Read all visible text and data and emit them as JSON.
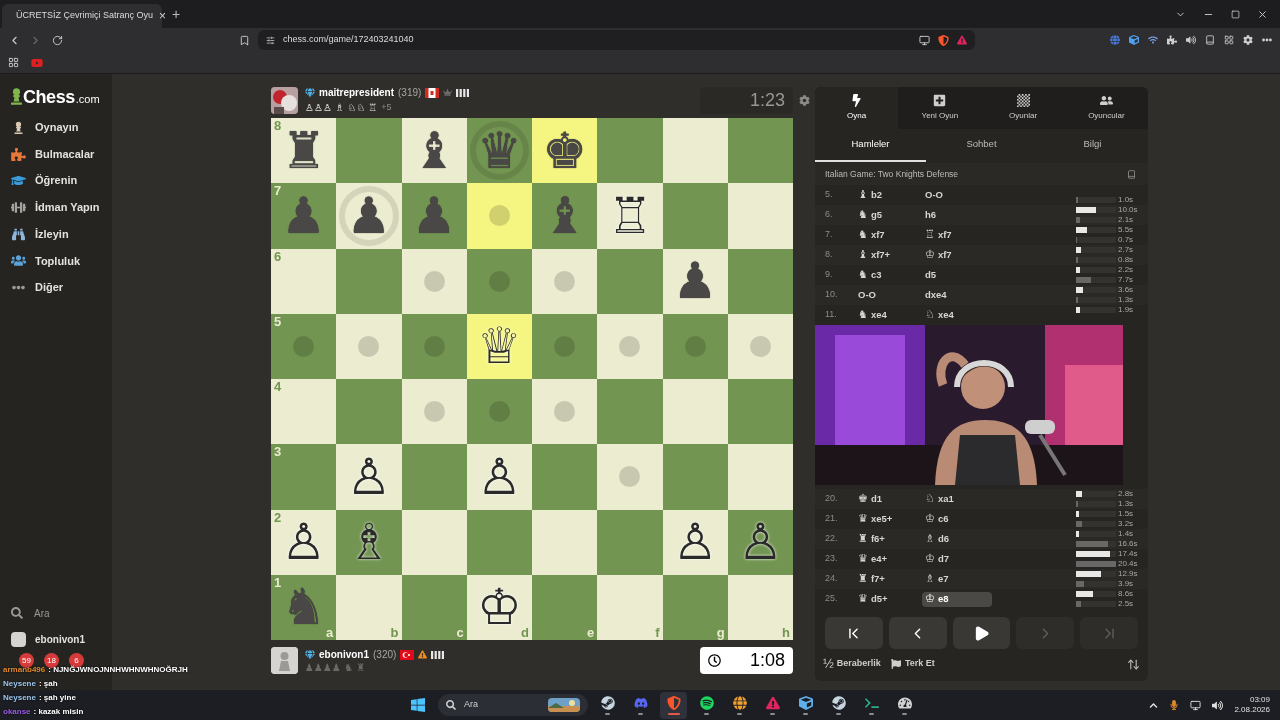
{
  "browser": {
    "tab_title": "ÜCRETSİZ Çevrimiçi Satranç Oyu",
    "tab_close": "×",
    "new_tab": "+",
    "url": "chess.com/game/172403241040"
  },
  "sidebar": {
    "logo": "Chess",
    "logo_suffix": ".com",
    "items": [
      {
        "kind": "pawn",
        "label": "Oynayın",
        "color": "#d9cbb3"
      },
      {
        "kind": "puzzle",
        "label": "Bulmacalar",
        "color": "#e8773a"
      },
      {
        "kind": "cap",
        "label": "Öğrenin",
        "color": "#3b9bd8"
      },
      {
        "kind": "dumbbell",
        "label": "İdman Yapın",
        "color": "#a3a3a3"
      },
      {
        "kind": "binoculars",
        "label": "İzleyin",
        "color": "#8fb6d9"
      },
      {
        "kind": "people",
        "label": "Topluluk",
        "color": "#5ba2d9"
      },
      {
        "kind": "dots",
        "label": "Diğer",
        "color": "#9a9a9a"
      }
    ],
    "search": "Ara",
    "user": "ebonivon1"
  },
  "top_player": {
    "name": "maitrepresident",
    "rating": "(319)",
    "flag": {
      "kind": "canada"
    },
    "badge": {
      "kind": "crown"
    },
    "captured": "♙♙♙ ♗ ♘♘ ♖",
    "advantage": "+5",
    "clock": "1:23",
    "active": false
  },
  "board": {
    "ranks": [
      {
        "squares": [
          {
            "piece": "♜",
            "white": false,
            "highlighted": false,
            "rank_label": "8"
          },
          {
            "highlighted": false
          },
          {
            "piece": "♝",
            "white": false,
            "highlighted": false
          },
          {
            "piece": "♛",
            "white": false,
            "highlighted": false,
            "kind": "capture"
          },
          {
            "piece": "♚",
            "white": false,
            "highlighted": true
          },
          {
            "highlighted": false
          },
          {
            "highlighted": false
          },
          {
            "highlighted": false
          }
        ]
      },
      {
        "squares": [
          {
            "piece": "♟",
            "white": false,
            "highlighted": false,
            "rank_label": "7"
          },
          {
            "piece": "♟",
            "white": false,
            "highlighted": false,
            "kind": "capture"
          },
          {
            "piece": "♟",
            "white": false,
            "highlighted": false
          },
          {
            "highlighted": true,
            "kind": "dot"
          },
          {
            "piece": "♝",
            "white": false,
            "highlighted": false
          },
          {
            "piece": "♖",
            "white": true,
            "highlighted": false
          },
          {
            "highlighted": false
          },
          {
            "highlighted": false
          }
        ]
      },
      {
        "squares": [
          {
            "highlighted": false,
            "rank_label": "6"
          },
          {
            "highlighted": false
          },
          {
            "highlighted": false,
            "kind": "dot"
          },
          {
            "highlighted": false,
            "kind": "dot"
          },
          {
            "highlighted": false,
            "kind": "dot"
          },
          {
            "highlighted": false
          },
          {
            "piece": "♟",
            "white": false,
            "highlighted": false
          },
          {
            "highlighted": false
          }
        ]
      },
      {
        "squares": [
          {
            "highlighted": false,
            "kind": "dot",
            "rank_label": "5"
          },
          {
            "highlighted": false,
            "kind": "dot"
          },
          {
            "highlighted": false,
            "kind": "dot"
          },
          {
            "piece": "♕",
            "white": true,
            "highlighted": true
          },
          {
            "highlighted": false,
            "kind": "dot"
          },
          {
            "highlighted": false,
            "kind": "dot"
          },
          {
            "highlighted": false,
            "kind": "dot"
          },
          {
            "highlighted": false,
            "kind": "dot"
          }
        ]
      },
      {
        "squares": [
          {
            "highlighted": false,
            "rank_label": "4"
          },
          {
            "highlighted": false
          },
          {
            "highlighted": false,
            "kind": "dot"
          },
          {
            "highlighted": false,
            "kind": "dot"
          },
          {
            "highlighted": false,
            "kind": "dot"
          },
          {
            "highlighted": false
          },
          {
            "highlighted": false
          },
          {
            "highlighted": false
          }
        ]
      },
      {
        "squares": [
          {
            "highlighted": false,
            "rank_label": "3"
          },
          {
            "piece": "♙",
            "white": true,
            "highlighted": false
          },
          {
            "highlighted": false
          },
          {
            "piece": "♙",
            "white": true,
            "highlighted": false
          },
          {
            "highlighted": false
          },
          {
            "highlighted": false,
            "kind": "dot"
          },
          {
            "highlighted": false
          },
          {
            "highlighted": false
          }
        ]
      },
      {
        "squares": [
          {
            "piece": "♙",
            "white": true,
            "highlighted": false,
            "rank_label": "2"
          },
          {
            "piece": "♗",
            "white": true,
            "highlighted": false
          },
          {
            "highlighted": false
          },
          {
            "highlighted": false
          },
          {
            "highlighted": false
          },
          {
            "highlighted": false
          },
          {
            "piece": "♙",
            "white": true,
            "highlighted": false
          },
          {
            "piece": "♙",
            "white": true,
            "highlighted": false
          }
        ]
      },
      {
        "squares": [
          {
            "piece": "♞",
            "white": false,
            "highlighted": false,
            "rank_label": "1",
            "file_label": "a"
          },
          {
            "highlighted": false,
            "file_label": "b"
          },
          {
            "highlighted": false,
            "file_label": "c"
          },
          {
            "piece": "♔",
            "white": true,
            "highlighted": false,
            "file_label": "d"
          },
          {
            "highlighted": false,
            "file_label": "e"
          },
          {
            "highlighted": false,
            "file_label": "f"
          },
          {
            "highlighted": false,
            "file_label": "g"
          },
          {
            "highlighted": false,
            "file_label": "h"
          }
        ]
      }
    ]
  },
  "bottom_player": {
    "name": "ebonivon1",
    "rating": "(320)",
    "flag": {
      "kind": "turkey"
    },
    "badge": {
      "kind": "warning"
    },
    "captured": "♟♟♟♟ ♞ ♜",
    "clock": "1:08",
    "active": true
  },
  "panel": {
    "tabs": [
      {
        "kind": "bolt",
        "label": "Oyna",
        "selected": true
      },
      {
        "kind": "plus",
        "label": "Yeni Oyun",
        "selected": false
      },
      {
        "kind": "board",
        "label": "Oyunlar",
        "selected": false
      },
      {
        "kind": "users",
        "label": "Oyuncular",
        "selected": false
      }
    ],
    "subtabs": [
      {
        "label": "Hamleler",
        "selected": true
      },
      {
        "label": "Sohbet",
        "selected": false
      },
      {
        "label": "Bilgi",
        "selected": false
      }
    ],
    "opening": "Italian Game: Two Knights Defense",
    "moves_before": [
      {
        "number": "5.",
        "white": {
          "piece": "♝",
          "san": "b2",
          "selected": false
        },
        "black": {
          "san": "O-O",
          "selected": false
        },
        "black_time": {
          "text": "1.0s",
          "level": 0.05
        }
      },
      {
        "number": "6.",
        "white": {
          "piece": "♞",
          "san": "g5",
          "selected": false
        },
        "black": {
          "san": "h6",
          "selected": false
        },
        "white_time": {
          "text": "10.0s",
          "level": 0.49
        },
        "black_time": {
          "text": "2.1s",
          "level": 0.1
        }
      },
      {
        "number": "7.",
        "white": {
          "piece": "♞",
          "san": "xf7",
          "selected": false
        },
        "black": {
          "piece": "♖",
          "san": "xf7",
          "selected": false
        },
        "white_time": {
          "text": "5.5s",
          "level": 0.27
        },
        "black_time": {
          "text": "0.7s",
          "level": 0.03
        }
      },
      {
        "number": "8.",
        "white": {
          "piece": "♝",
          "san": "xf7+",
          "selected": false
        },
        "black": {
          "piece": "♔",
          "san": "xf7",
          "selected": false
        },
        "white_time": {
          "text": "2.7s",
          "level": 0.13
        },
        "black_time": {
          "text": "0.8s",
          "level": 0.04
        }
      },
      {
        "number": "9.",
        "white": {
          "piece": "♞",
          "san": "c3",
          "selected": false
        },
        "black": {
          "san": "d5",
          "selected": false
        },
        "white_time": {
          "text": "2.2s",
          "level": 0.11
        },
        "black_time": {
          "text": "7.7s",
          "level": 0.38
        }
      },
      {
        "number": "10.",
        "white": {
          "san": "O-O",
          "selected": false
        },
        "black": {
          "san": "dxe4",
          "selected": false
        },
        "white_time": {
          "text": "3.6s",
          "level": 0.18
        },
        "black_time": {
          "text": "1.3s",
          "level": 0.06
        }
      },
      {
        "number": "11.",
        "white": {
          "piece": "♞",
          "san": "xe4",
          "selected": false
        },
        "black": {
          "piece": "♘",
          "san": "xe4",
          "selected": false
        },
        "white_time": {
          "text": "1.9s",
          "level": 0.09
        }
      }
    ],
    "moves_after": [
      {
        "number": "20.",
        "white": {
          "piece": "♚",
          "san": "d1",
          "selected": false
        },
        "black": {
          "piece": "♘",
          "san": "xa1",
          "selected": false
        },
        "white_time": {
          "text": "2.8s",
          "level": 0.14
        },
        "black_time": {
          "text": "1.3s",
          "level": 0.06
        }
      },
      {
        "number": "21.",
        "white": {
          "piece": "♛",
          "san": "xe5+",
          "selected": false
        },
        "black": {
          "piece": "♔",
          "san": "c6",
          "selected": false
        },
        "white_time": {
          "text": "1.5s",
          "level": 0.07
        },
        "black_time": {
          "text": "3.2s",
          "level": 0.16
        }
      },
      {
        "number": "22.",
        "white": {
          "piece": "♜",
          "san": "f6+",
          "selected": false
        },
        "black": {
          "piece": "♗",
          "san": "d6",
          "selected": false
        },
        "white_time": {
          "text": "1.4s",
          "level": 0.07
        },
        "black_time": {
          "text": "16.6s",
          "level": 0.81
        }
      },
      {
        "number": "23.",
        "white": {
          "piece": "♛",
          "san": "e4+",
          "selected": false
        },
        "black": {
          "piece": "♔",
          "san": "d7",
          "selected": false
        },
        "white_time": {
          "text": "17.4s",
          "level": 0.85
        },
        "black_time": {
          "text": "20.4s",
          "level": 1
        }
      },
      {
        "number": "24.",
        "white": {
          "piece": "♜",
          "san": "f7+",
          "selected": false
        },
        "black": {
          "piece": "♗",
          "san": "e7",
          "selected": false
        },
        "white_time": {
          "text": "12.9s",
          "level": 0.63
        },
        "black_time": {
          "text": "3.9s",
          "level": 0.19
        }
      },
      {
        "number": "25.",
        "white": {
          "piece": "♛",
          "san": "d5+",
          "selected": false
        },
        "black": {
          "piece": "♔",
          "san": "e8",
          "selected": true
        },
        "white_time": {
          "text": "8.6s",
          "level": 0.42
        },
        "black_time": {
          "text": "2.5s",
          "level": 0.12
        }
      }
    ],
    "nav": [
      {
        "kind": "first",
        "disabled": false
      },
      {
        "kind": "prev",
        "disabled": false
      },
      {
        "kind": "play",
        "disabled": false
      },
      {
        "kind": "next",
        "disabled": true
      },
      {
        "kind": "last",
        "disabled": true
      }
    ],
    "draw_glyph": "½",
    "draw_label": "Beraberlik",
    "resign_label": "Terk Et"
  },
  "chat": {
    "badges": [
      "59",
      "18",
      "6"
    ],
    "messages": [
      {
        "user": "armanb496",
        "text": ": NJNĞJWNOJNNHWHNWHNOĞRJH",
        "color": "#e0892e"
      },
      {
        "user": "Neysene",
        "text": ": şah",
        "color": "#9fc7ee"
      },
      {
        "user": "Neysene",
        "text": ": şah yine",
        "color": "#9fc7ee"
      },
      {
        "user": "okanse",
        "text": ": kazak misin",
        "color": "#9b5de5"
      }
    ]
  },
  "taskbar": {
    "search": "Ara",
    "apps": [
      {
        "kind": "steam",
        "selected": false
      },
      {
        "kind": "discord",
        "selected": false
      },
      {
        "kind": "brave",
        "selected": true
      },
      {
        "kind": "spotify",
        "selected": false
      },
      {
        "kind": "globe",
        "selected": false
      },
      {
        "kind": "triangle",
        "selected": false
      },
      {
        "kind": "cube",
        "selected": false
      },
      {
        "kind": "steam",
        "selected": false
      },
      {
        "kind": "terminal",
        "selected": false
      },
      {
        "kind": "gauge",
        "selected": false
      }
    ],
    "time": "03:09",
    "date": "2.08.2026"
  }
}
